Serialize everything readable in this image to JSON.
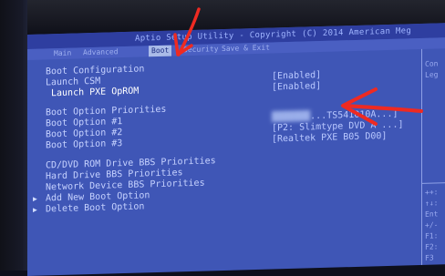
{
  "bios": {
    "title": "Aptio Setup Utility - Copyright (C) 2014 American Meg",
    "tabs": [
      {
        "label": "Main"
      },
      {
        "label": "Advanced"
      },
      {
        "label": "Boot"
      },
      {
        "label": "Security"
      },
      {
        "label": "Save & Exit"
      },
      {
        "label": ""
      }
    ],
    "section_boot_config": "Boot Configuration",
    "launch_csm": {
      "label": "Launch CSM",
      "value": "[Enabled]"
    },
    "launch_pxe": {
      "label": "Launch PXE OpROM",
      "value": "[Enabled]"
    },
    "section_boot_priorities": "Boot Option Priorities",
    "boot_options": [
      {
        "label": "Boot Option #1",
        "value": "...TS541010A...]"
      },
      {
        "label": "Boot Option #2",
        "value": "[P2: Slimtype DVD A ...]"
      },
      {
        "label": "Boot Option #3",
        "value": "[Realtek PXE B05 D00]"
      }
    ],
    "bbs": [
      {
        "label": "CD/DVD ROM Drive BBS Priorities"
      },
      {
        "label": "Hard Drive BBS Priorities"
      },
      {
        "label": "Network Device BBS Priorities"
      }
    ],
    "add_boot": "Add New Boot Option",
    "delete_boot": "Delete Boot Option",
    "help_top": [
      "Con",
      "Leg"
    ],
    "help_bottom": [
      "++:",
      "↑↓:",
      "Ent",
      "+/-",
      "F1:",
      "F2:",
      "F3"
    ]
  },
  "colors": {
    "screen_bg": "#3f56b6",
    "text": "#c6d2ff",
    "annotation": "#ee2a22"
  }
}
